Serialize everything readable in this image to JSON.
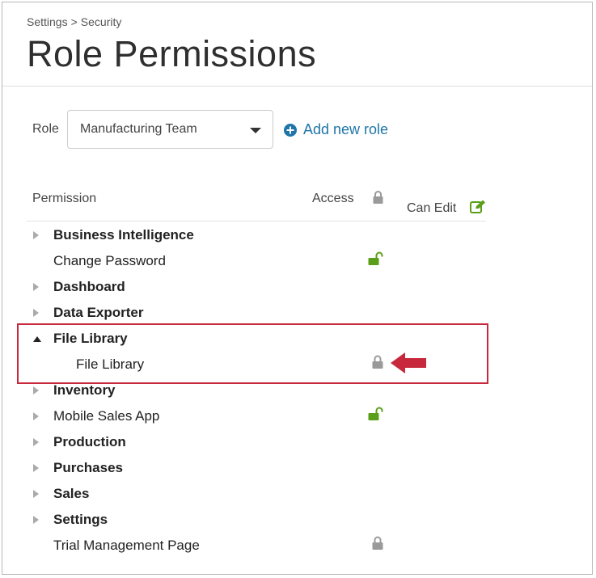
{
  "breadcrumb": {
    "parent": "Settings",
    "separator": ">",
    "current": "Security"
  },
  "page_title": "Role Permissions",
  "role": {
    "label": "Role",
    "selected": "Manufacturing Team",
    "add_label": "Add new role"
  },
  "table": {
    "headers": {
      "permission": "Permission",
      "access": "Access",
      "can_edit": "Can Edit"
    },
    "rows": [
      {
        "label": "Business Intelligence",
        "bold": true,
        "expander": "collapsed",
        "access": ""
      },
      {
        "label": "Change Password",
        "bold": false,
        "expander": "none",
        "access": "unlocked"
      },
      {
        "label": "Dashboard",
        "bold": true,
        "expander": "collapsed",
        "access": ""
      },
      {
        "label": "Data Exporter",
        "bold": true,
        "expander": "collapsed",
        "access": ""
      },
      {
        "label": "File Library",
        "bold": true,
        "expander": "expanded",
        "access": ""
      },
      {
        "label": "File Library",
        "bold": false,
        "expander": "child",
        "access": "locked"
      },
      {
        "label": "Inventory",
        "bold": true,
        "expander": "collapsed",
        "access": ""
      },
      {
        "label": "Mobile Sales App",
        "bold": false,
        "expander": "collapsed",
        "access": "unlocked"
      },
      {
        "label": "Production",
        "bold": true,
        "expander": "collapsed",
        "access": ""
      },
      {
        "label": "Purchases",
        "bold": true,
        "expander": "collapsed",
        "access": ""
      },
      {
        "label": "Sales",
        "bold": true,
        "expander": "collapsed",
        "access": ""
      },
      {
        "label": "Settings",
        "bold": true,
        "expander": "collapsed",
        "access": ""
      },
      {
        "label": "Trial Management Page",
        "bold": false,
        "expander": "none",
        "access": "locked"
      }
    ]
  },
  "icons": {
    "header_access": "lock-icon",
    "header_edit": "edit-icon",
    "add_role": "plus-circle-icon",
    "locked": "lock-icon",
    "unlocked": "unlock-icon",
    "annotation": "arrow-left-icon"
  },
  "colors": {
    "link": "#1f75a8",
    "unlocked": "#5b9e1a",
    "locked": "#9a9a9a",
    "highlight": "#c8283c",
    "edit": "#5b9e1a"
  }
}
